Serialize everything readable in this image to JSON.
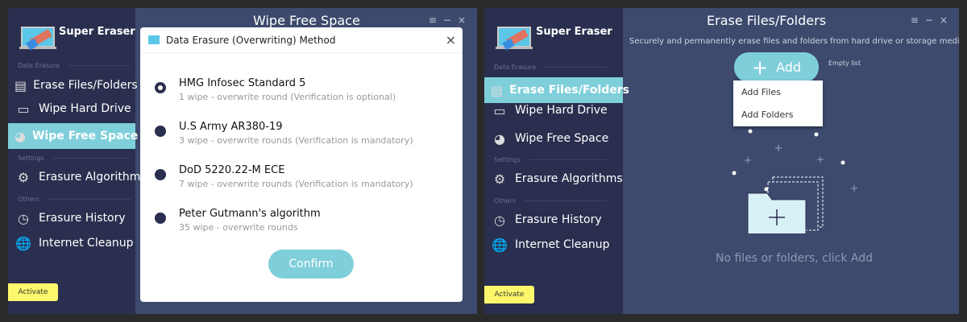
{
  "brand": "Super Eraser",
  "sections": {
    "data_erasure": "Data Erasure",
    "settings": "Settings",
    "others": "Others"
  },
  "nav": [
    "Erase Files/Folders",
    "Wipe Hard Drive",
    "Wipe Free Space",
    "Erasure Algorithms",
    "Erasure History",
    "Internet Cleanup"
  ],
  "activate": "Activate",
  "left_window": {
    "title": "Wipe Free Space",
    "active": "Wipe Free Space"
  },
  "dialog": {
    "title": "Data Erasure (Overwriting) Method",
    "confirm": "Confirm",
    "selected": 0,
    "options": [
      {
        "name": "HMG Infosec Standard 5",
        "desc": "1 wipe - overwrite round (Verification is optional)"
      },
      {
        "name": "U.S Army AR380-19",
        "desc": "3 wipe - overwrite rounds (Verification is mandatory)"
      },
      {
        "name": "DoD 5220.22-M ECE",
        "desc": "7 wipe - overwrite rounds (Verification is mandatory)"
      },
      {
        "name": "Peter Gutmann's algorithm",
        "desc": "35 wipe - overwrite rounds"
      }
    ]
  },
  "right_window": {
    "title": "Erase Files/Folders",
    "active": "Erase Files/Folders",
    "subtitle": "Securely and permanently erase files and folders from hard drive or storage media device.",
    "add": "Add",
    "empty": "Empty list",
    "menu": [
      "Add Files",
      "Add Folders"
    ],
    "hint": "No files or folders, click Add"
  },
  "controls": {
    "menu": "≡",
    "minimize": "−",
    "close": "×"
  },
  "colors": {
    "accent": "#7fcfdb",
    "sidebar": "#2a2f4f",
    "main": "#3d4a6d"
  }
}
